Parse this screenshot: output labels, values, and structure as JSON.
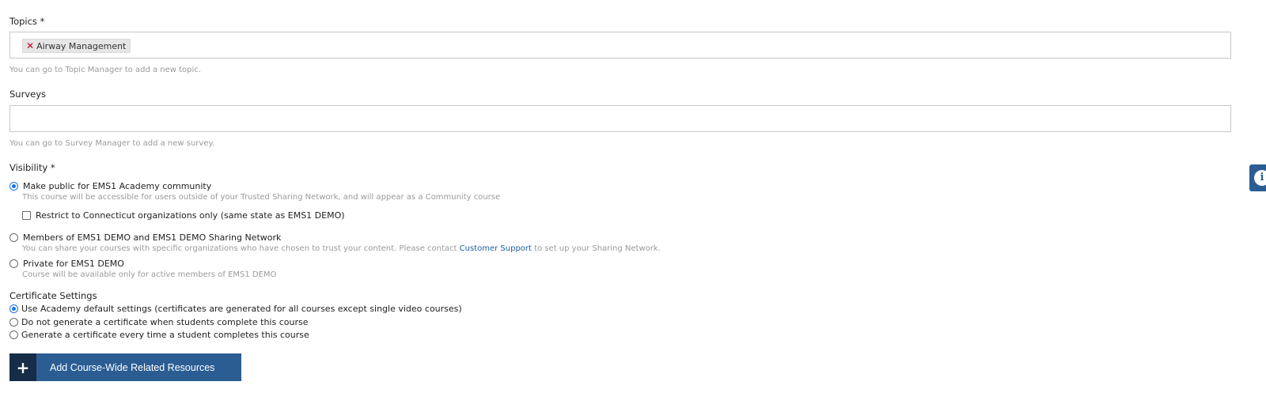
{
  "topics": {
    "label": "Topics *",
    "chips": [
      {
        "label": "Airway Management"
      }
    ],
    "help": "You can go to Topic Manager to add a new topic."
  },
  "surveys": {
    "label": "Surveys",
    "help": "You can go to Survey Manager to add a new survey."
  },
  "visibility": {
    "label": "Visibility *",
    "options": [
      {
        "label": "Make public for EMS1 Academy community",
        "description": "This course will be accessible for users outside of your Trusted Sharing Network, and will appear as a Community course",
        "selected": true
      },
      {
        "label": "Members of EMS1 DEMO and EMS1 DEMO Sharing Network",
        "description_before_link": "You can share your courses with specific organizations who have chosen to trust your content. Please contact ",
        "link": "Customer Support",
        "description_after_link": " to set up your Sharing Network.",
        "selected": false
      },
      {
        "label": "Private for EMS1 DEMO",
        "description": "Course will be available only for active members of EMS1 DEMO",
        "selected": false
      }
    ],
    "restrict_checkbox": {
      "label": "Restrict to Connecticut organizations only (same state as EMS1 DEMO)",
      "checked": false
    }
  },
  "certificate": {
    "label": "Certificate Settings",
    "options": [
      {
        "label": "Use Academy default settings (certificates are generated for all courses except single video courses)",
        "selected": true
      },
      {
        "label": "Do not generate a certificate when students complete this course",
        "selected": false
      },
      {
        "label": "Generate a certificate every time a student completes this course",
        "selected": false
      }
    ]
  },
  "add_resources_button": {
    "icon": "plus-icon",
    "label": "Add Course-Wide Related Resources"
  },
  "info_tab": {
    "icon": "info-icon",
    "glyph": "i"
  },
  "colors": {
    "primary": "#2b5d93",
    "primary_dark": "#162c47",
    "radio_selected": "#1a73e8",
    "remove_chip": "#d0021b",
    "link": "#1f5fa6"
  }
}
